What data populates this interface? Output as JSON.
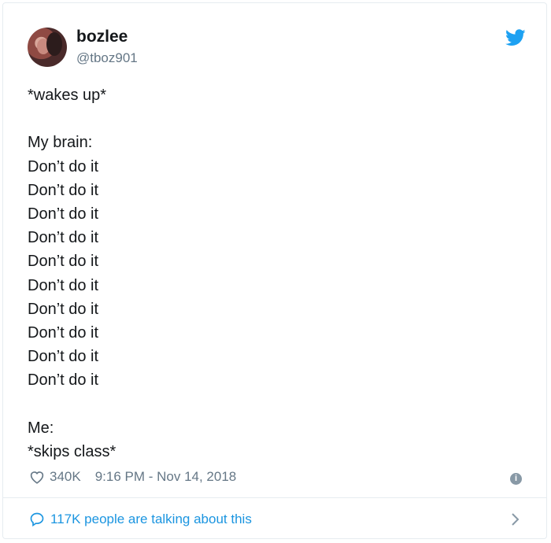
{
  "tweet": {
    "display_name": "bozlee",
    "handle": "@tboz901",
    "lines": [
      "*wakes up*",
      "",
      "My brain:",
      "Don’t do it",
      "Don’t do it",
      "Don’t do it",
      "Don’t do it",
      "Don’t do it",
      "Don’t do it",
      "Don’t do it",
      "Don’t do it",
      "Don’t do it",
      "Don’t do it",
      "",
      "Me:",
      "*skips class*"
    ],
    "likes": "340K",
    "timestamp": "9:16 PM - Nov 14, 2018",
    "conversation": "117K people are talking about this"
  },
  "icons": {
    "brand": "twitter-bird-icon",
    "like": "heart-icon",
    "info": "info-icon",
    "reply": "speech-bubble-icon",
    "more": "chevron-right-icon"
  },
  "colors": {
    "brand_blue": "#1da1f2",
    "link_blue": "#1b95e0",
    "muted_gray": "#657786",
    "text": "#14171a"
  }
}
